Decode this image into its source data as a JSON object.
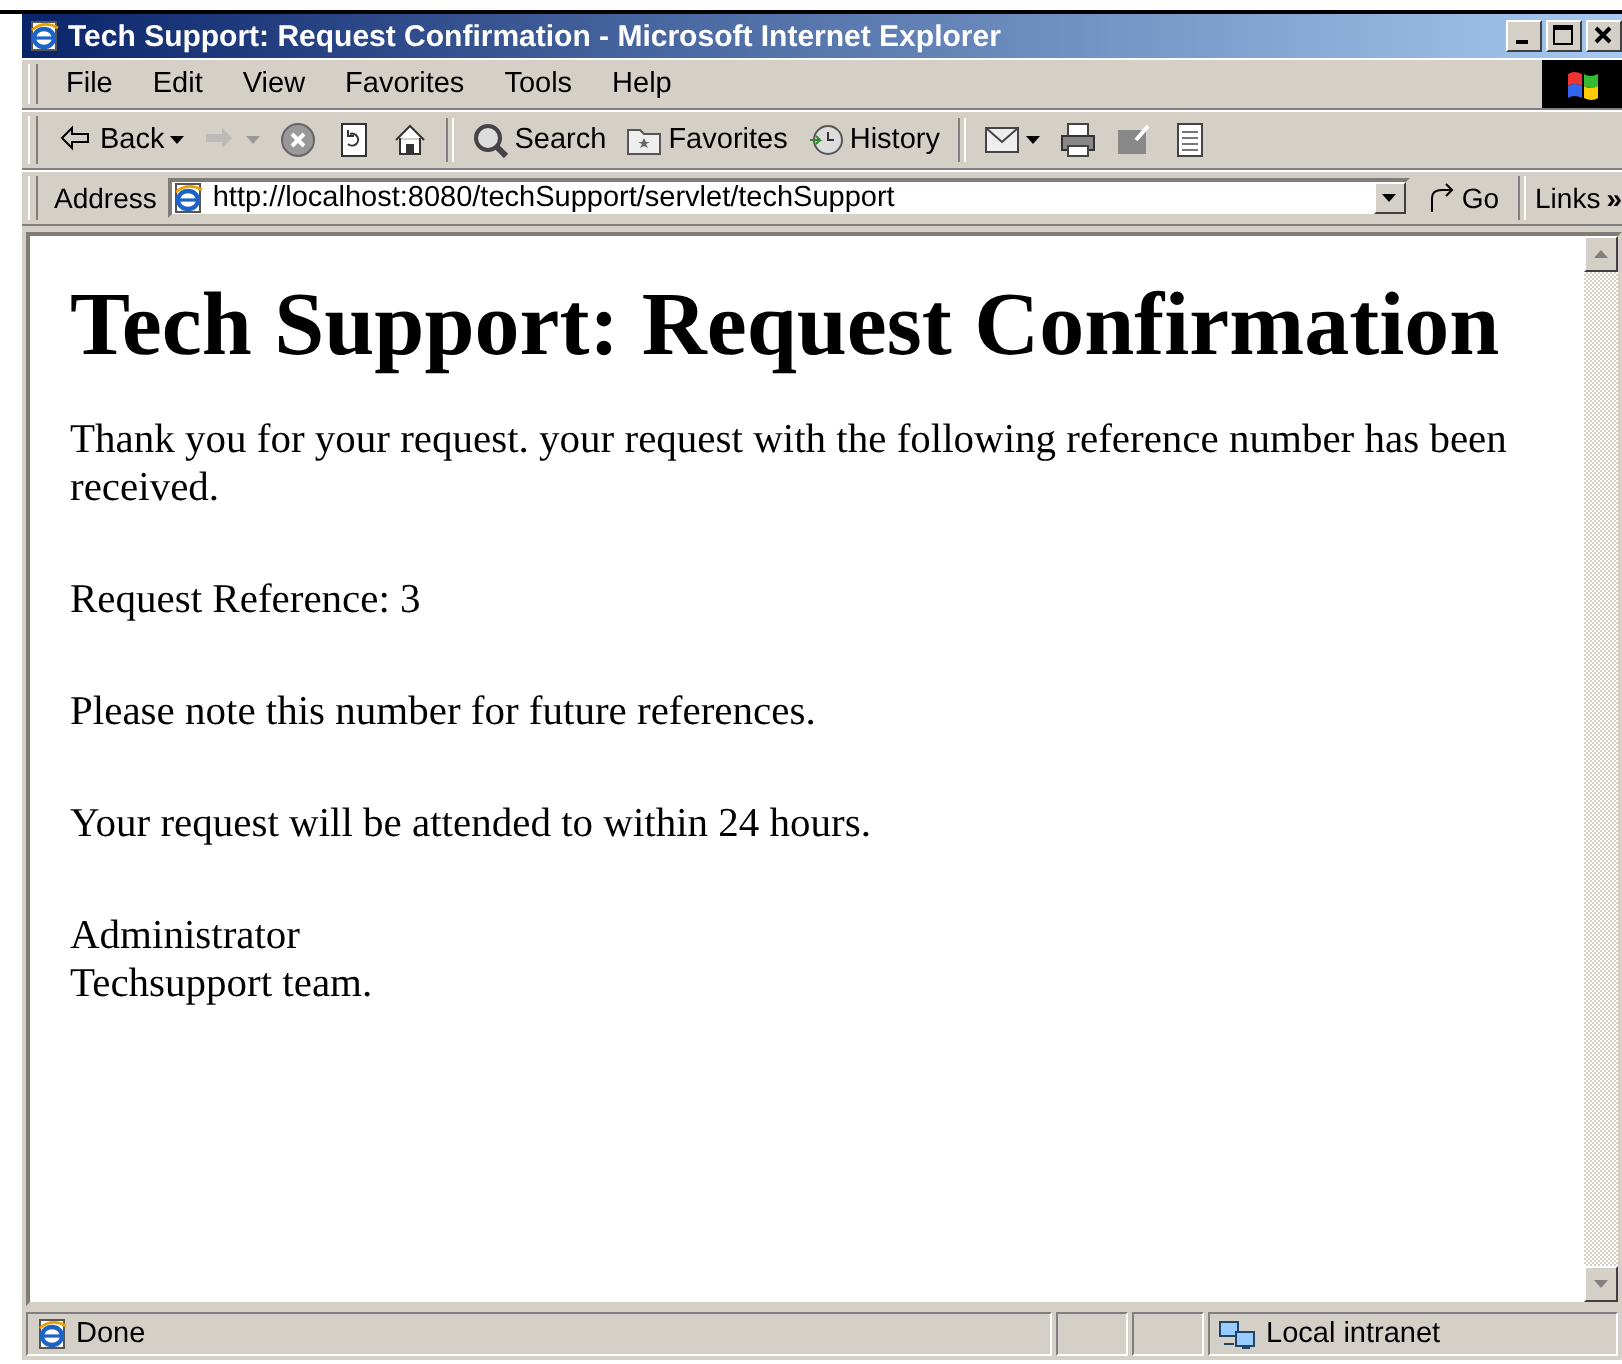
{
  "window": {
    "title": "Tech Support: Request Confirmation - Microsoft Internet Explorer"
  },
  "menu": [
    "File",
    "Edit",
    "View",
    "Favorites",
    "Tools",
    "Help"
  ],
  "toolbar": [
    {
      "kind": "labeled",
      "label": "Back",
      "dropdown": true,
      "disabled": false
    },
    {
      "kind": "icon",
      "dropdown": true,
      "disabled": true
    },
    {
      "kind": "icon",
      "dropdown": false,
      "disabled": false
    },
    {
      "kind": "icon",
      "dropdown": false,
      "disabled": false
    },
    {
      "kind": "icon",
      "dropdown": false,
      "disabled": false
    },
    {
      "kind": "separator"
    },
    {
      "kind": "labeled",
      "label": "Search",
      "dropdown": false,
      "disabled": false
    },
    {
      "kind": "labeled",
      "label": "Favorites",
      "dropdown": false,
      "disabled": false
    },
    {
      "kind": "labeled",
      "label": "History",
      "dropdown": false,
      "disabled": false
    },
    {
      "kind": "separator"
    },
    {
      "kind": "icon",
      "dropdown": true,
      "disabled": false
    },
    {
      "kind": "icon",
      "dropdown": false,
      "disabled": false
    },
    {
      "kind": "icon",
      "dropdown": false,
      "disabled": false
    },
    {
      "kind": "icon",
      "dropdown": false,
      "disabled": false
    }
  ],
  "address_bar": {
    "label": "Address",
    "value": "http://localhost:8080/techSupport/servlet/techSupport",
    "go": "Go",
    "links": "Links",
    "more": "»"
  },
  "page": {
    "heading": "Tech Support: Request Confirmation",
    "paragraphs": [
      {
        "lines": [
          "Thank you for your request. your request with the following reference number has been received."
        ]
      },
      {
        "lines": [
          "Request Reference: 3"
        ]
      },
      {
        "lines": [
          "Please note this number for future references."
        ]
      },
      {
        "lines": [
          "Your request will be attended to within 24 hours."
        ]
      },
      {
        "lines": [
          "Administrator",
          "Techsupport team."
        ]
      }
    ]
  },
  "status_bar": {
    "text": "Done",
    "zone": "Local intranet"
  }
}
